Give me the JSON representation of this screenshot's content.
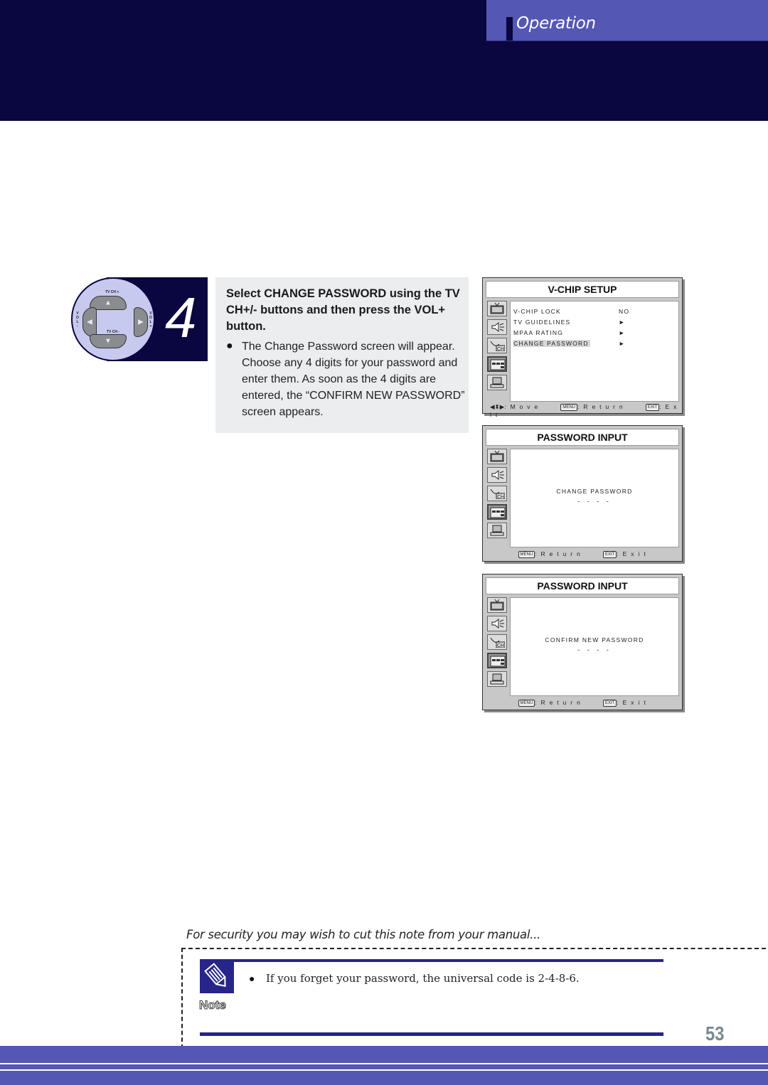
{
  "header": {
    "section_label": "Operation",
    "colors": {
      "navy": "#0a0640",
      "accent": "#5457b3"
    }
  },
  "step": {
    "number": "4",
    "remote": {
      "up_label": "TV CH +",
      "down_label": "TV CH -",
      "left_label": "VOL-",
      "right_label": "VOL+"
    },
    "heading": "Select CHANGE PASSWORD using the TV CH+/- buttons and then press the VOL+ button.",
    "bullet": "●",
    "body": "The Change Password screen will appear. Choose any 4 digits for your password and enter them. As soon as the 4 digits are entered, the “CONFIRM NEW PASSWORD” screen appears."
  },
  "osd": {
    "vchip": {
      "title": "V-CHIP SETUP",
      "icons": [
        "picture-icon",
        "sound-icon",
        "channel-icon",
        "setup-icon",
        "pc-icon"
      ],
      "items": [
        {
          "label": "V-CHIP LOCK",
          "value": "NO"
        },
        {
          "label": "TV GUIDELINES",
          "value": "►"
        },
        {
          "label": "MPAA RATING",
          "value": "►"
        },
        {
          "label": "CHANGE PASSWORD",
          "value": "►"
        }
      ],
      "footer": {
        "move_glyph": "◀⬍▶",
        "move": ": M o v e",
        "menu_key": "MENU",
        "return": ": R e t u r n",
        "exit_key": "EXIT",
        "exit": ": E x i t"
      }
    },
    "password_change": {
      "title": "PASSWORD INPUT",
      "label": "CHANGE PASSWORD",
      "dashes": "- - - -",
      "footer": {
        "menu_key": "MENU",
        "return": ": R e t u r n",
        "exit_key": "EXIT",
        "exit": ": E x i t"
      }
    },
    "password_confirm": {
      "title": "PASSWORD INPUT",
      "label": "CONFIRM NEW PASSWORD",
      "dashes": "- - - -",
      "footer": {
        "menu_key": "MENU",
        "return": ": R e t u r n",
        "exit_key": "EXIT",
        "exit": ": E x i t"
      }
    }
  },
  "note": {
    "caption": "For security you may wish to cut this note from your manual...",
    "label": "Note",
    "bullet": "●",
    "text": "If you forget your password, the universal code is 2-4-8-6."
  },
  "page_number": "53"
}
